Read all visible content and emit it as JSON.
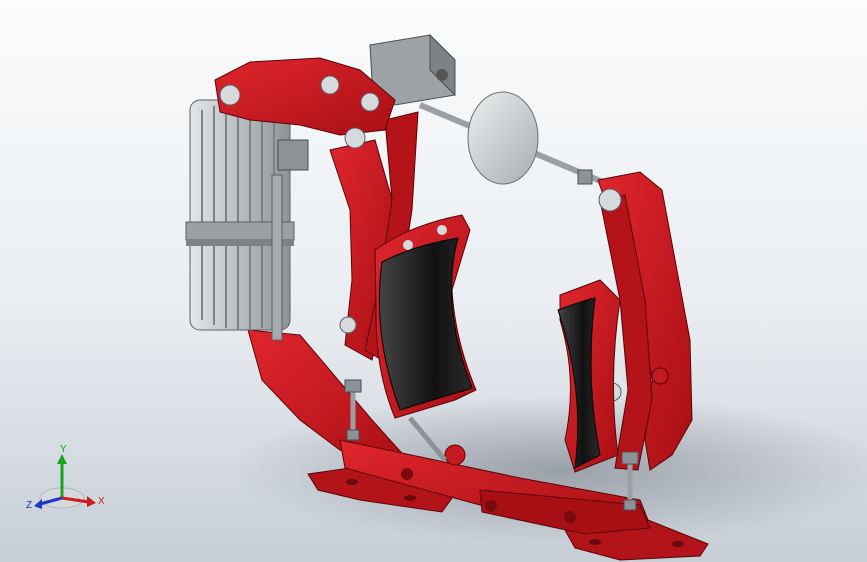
{
  "viewport": {
    "background_top": "#fbfcfd",
    "background_bottom": "#c7ced6",
    "model_color": "#c8161d",
    "model_shadow_color": "#8f0d12",
    "lining_color": "#1e1e1e",
    "motor_color": "#bfc3c6"
  },
  "triad": {
    "x_label": "X",
    "y_label": "Y",
    "z_label": "Z",
    "x_color": "#d01b1b",
    "y_color": "#1ea21e",
    "z_color": "#2035c9"
  }
}
